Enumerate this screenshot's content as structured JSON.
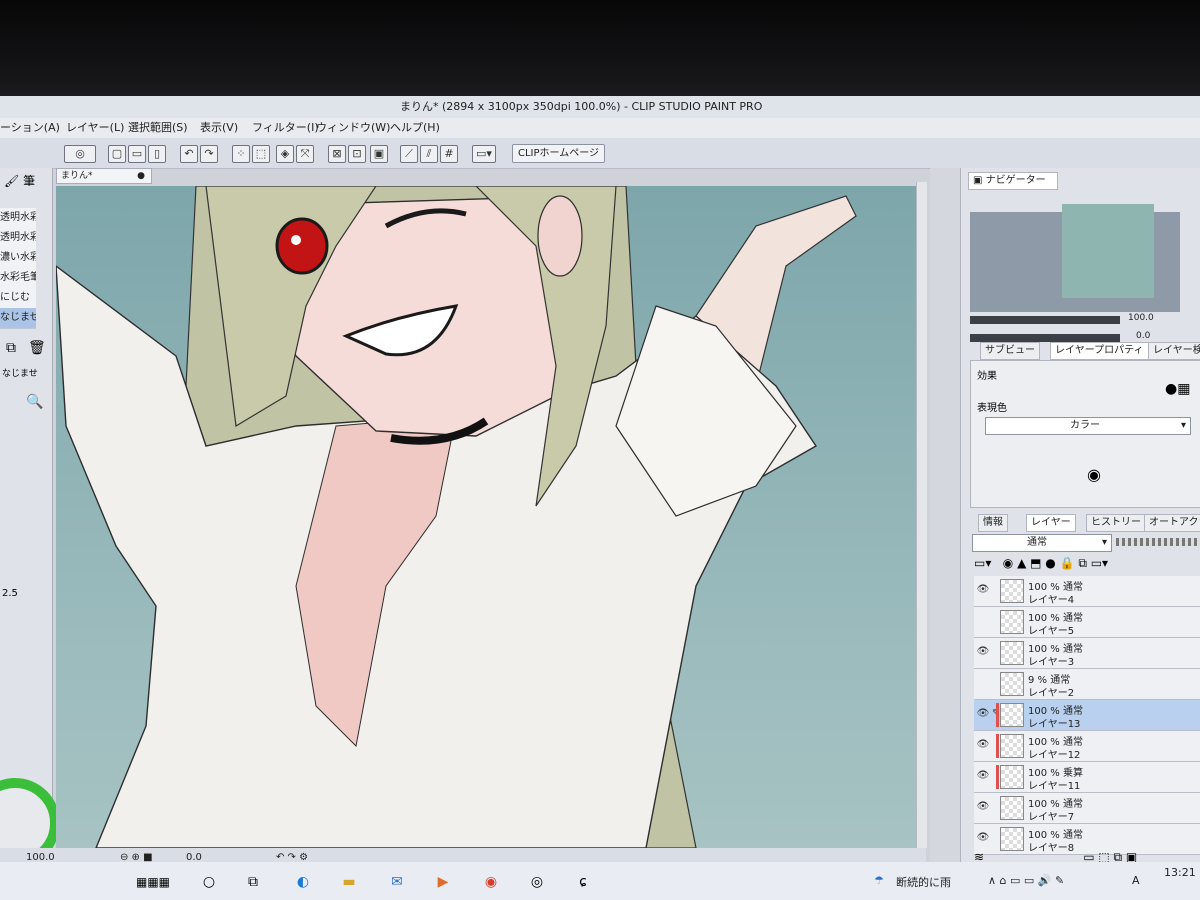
{
  "window": {
    "title": "まりん* (2894 x 3100px 350dpi 100.0%) - CLIP STUDIO PAINT PRO"
  },
  "menu": [
    "ーション(A)",
    "レイヤー(L)",
    "選択範囲(S)",
    "表示(V)",
    "フィルター(I)",
    "ウィンドウ(W)",
    "ヘルプ(H)"
  ],
  "toolbar": {
    "clip_home": "CLIPホームページ"
  },
  "document": {
    "tab": "まりん*"
  },
  "left_panel": {
    "header": "筆",
    "brushes": [
      "透明水彩",
      "透明水彩",
      "濃い水彩",
      "水彩毛筆",
      "にじむ",
      "なじませ"
    ],
    "selected_index": 5,
    "label_najimase": "なじませ",
    "size_value": "2.5",
    "colorwheel_accent": "#3bbf3a"
  },
  "status": {
    "zoom": "100.0",
    "angle": "0.0"
  },
  "navigator": {
    "tab": "ナビゲーター",
    "zoom": "100.0",
    "rotation": "0.0"
  },
  "properties": {
    "tabs": [
      "サブビュー",
      "レイヤープロパティ",
      "レイヤー検索"
    ],
    "effect_label": "効果",
    "expression_label": "表現色",
    "expression_value": "カラー"
  },
  "layers_panel": {
    "tabs": [
      "情報",
      "レイヤー",
      "ヒストリー",
      "オートアクション"
    ],
    "blend_mode": "通常",
    "layers": [
      {
        "opacity": "100 % 通常",
        "name": "レイヤー4",
        "visible": true,
        "selected": false,
        "marked": false
      },
      {
        "opacity": "100 % 通常",
        "name": "レイヤー5",
        "visible": false,
        "selected": false,
        "marked": false
      },
      {
        "opacity": "100 % 通常",
        "name": "レイヤー3",
        "visible": true,
        "selected": false,
        "marked": false
      },
      {
        "opacity": "9 % 通常",
        "name": "レイヤー2",
        "visible": false,
        "selected": false,
        "marked": false
      },
      {
        "opacity": "100 % 通常",
        "name": "レイヤー13",
        "visible": true,
        "selected": true,
        "marked": true
      },
      {
        "opacity": "100 % 通常",
        "name": "レイヤー12",
        "visible": true,
        "selected": false,
        "marked": true
      },
      {
        "opacity": "100 % 乗算",
        "name": "レイヤー11",
        "visible": true,
        "selected": false,
        "marked": true
      },
      {
        "opacity": "100 % 通常",
        "name": "レイヤー7",
        "visible": true,
        "selected": false,
        "marked": false
      },
      {
        "opacity": "100 % 通常",
        "name": "レイヤー8",
        "visible": true,
        "selected": false,
        "marked": false
      }
    ]
  },
  "taskbar": {
    "weather": "断続的に雨",
    "ime": "A",
    "time": "13:21"
  }
}
